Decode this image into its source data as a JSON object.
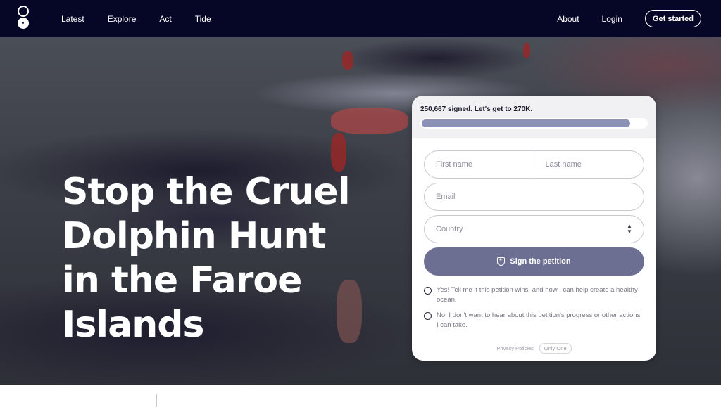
{
  "header": {
    "nav": [
      "Latest",
      "Explore",
      "Act",
      "Tide"
    ],
    "about": "About",
    "login": "Login",
    "get_started": "Get started"
  },
  "hero": {
    "title": "Stop the Cruel Dolphin Hunt in the Faroe Islands"
  },
  "petition": {
    "signed_text": "250,667 signed. Let's get to 270K.",
    "progress_fraction": 0.928,
    "first_name_placeholder": "First name",
    "last_name_placeholder": "Last name",
    "email_placeholder": "Email",
    "country_placeholder": "Country",
    "sign_button": "Sign the petition",
    "option_yes": "Yes! Tell me if this petition wins, and how I can help create a healthy ocean.",
    "option_no": "No. I don't want to hear about this petition's progress or other actions I can take.",
    "privacy": "Privacy Policies",
    "only_one": "Only One"
  },
  "colors": {
    "topbar": "#060626",
    "accent_button": "#6c6f92",
    "progress_fill": "#8c91b6"
  },
  "icons": [
    "logo-icon",
    "shield-icon",
    "select-caret-icon"
  ]
}
